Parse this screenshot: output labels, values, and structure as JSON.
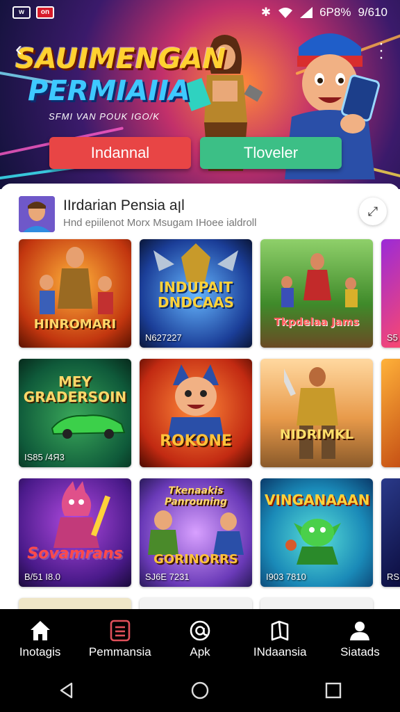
{
  "status_bar": {
    "time": "9/610",
    "battery": "6P8%"
  },
  "hero": {
    "title_line1": "SAUIMENGAN",
    "title_line2": "PERMIAIIA",
    "subtitle": "SFMI VAN POUK IGO/K",
    "button_left": "Indannal",
    "button_right": "Tloveler",
    "colors": {
      "button_left": "#e84545",
      "button_right": "#3cbf86"
    }
  },
  "app": {
    "name": "IIrdarian Pensia aןl",
    "description": "Hnd epiilenot Morx Msugam IHoee ialdroll"
  },
  "tiles": [
    {
      "title": "HINROMARI",
      "caption": ""
    },
    {
      "title": "INDUPAIT DNDCAAS",
      "caption": "N627227"
    },
    {
      "title": "Tkpdelaa Jams",
      "caption": ""
    },
    {
      "title": "",
      "caption": "S5"
    },
    {
      "title": "MEY GRADERSOIN",
      "caption": "IS85 /4Я3"
    },
    {
      "title": "ROKONE",
      "caption": ""
    },
    {
      "title": "NIDRIMKL",
      "caption": ""
    },
    {
      "title": "",
      "caption": ""
    },
    {
      "title": "Sovamrans",
      "caption": "B/51 I8.0"
    },
    {
      "title": "GORINORRS",
      "caption": "SJ6E 7231",
      "top_text": "Tkenaakis Panrouning"
    },
    {
      "title": "VINGANAAAN",
      "caption": "I903 7810"
    },
    {
      "title": "",
      "caption": "RS"
    }
  ],
  "nav": {
    "items": [
      {
        "label": "Inotagis",
        "icon": "home-icon"
      },
      {
        "label": "Pemmansia",
        "icon": "list-icon"
      },
      {
        "label": "Apk",
        "icon": "at-icon"
      },
      {
        "label": "INdaansia",
        "icon": "book-icon"
      },
      {
        "label": "Siatads",
        "icon": "person-icon"
      }
    ],
    "active_color": "#e0505a"
  }
}
